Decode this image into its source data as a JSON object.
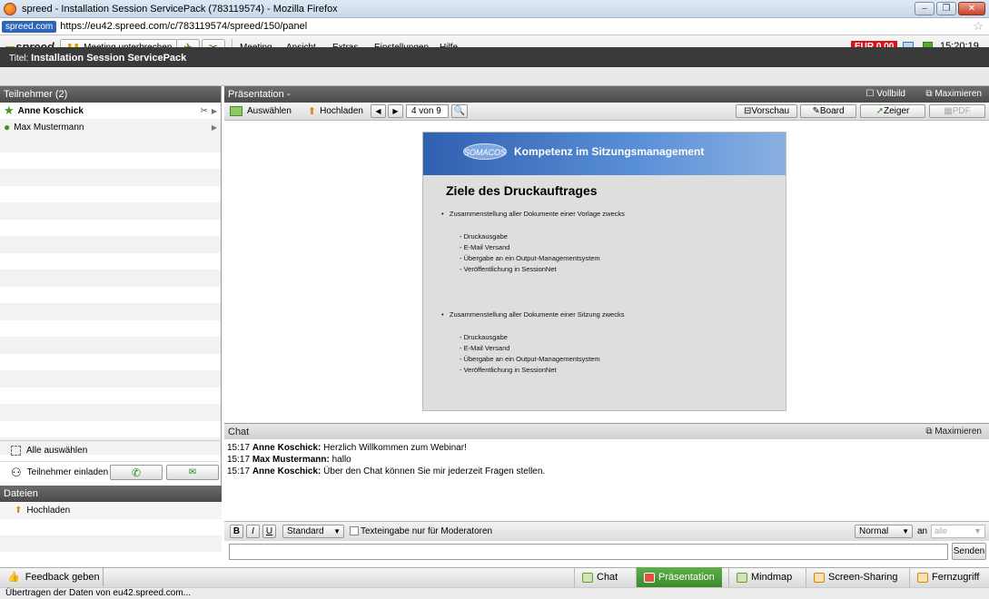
{
  "window": {
    "title": "spreed - Installation Session ServicePack (783119574) - Mozilla Firefox"
  },
  "urlbar": {
    "site": "spreed.com",
    "url": "https://eu42.spreed.com/c/783119574/spreed/150/panel"
  },
  "toolbar": {
    "logo": "spreed",
    "pause_label": "Meeting unterbrechen",
    "menu": [
      "Meeting",
      "Ansicht",
      "Extras",
      "Einstellungen",
      "Hilfe"
    ],
    "balance": "EUR 0,00",
    "time": "15:20:19"
  },
  "session": {
    "label": "Titel:",
    "title": "Installation Session ServicePack"
  },
  "participants": {
    "header": "Teilnehmer (2)",
    "items": [
      {
        "name": "Anne Koschick"
      },
      {
        "name": "Max Mustermann"
      }
    ],
    "select_all": "Alle auswählen",
    "invite": "Teilnehmer einladen"
  },
  "files": {
    "header": "Dateien",
    "upload": "Hochladen"
  },
  "presentation": {
    "header": "Präsentation -",
    "fullscreen": "Vollbild",
    "maximize": "Maximieren",
    "select": "Auswählen",
    "upload": "Hochladen",
    "page": "4 von 9",
    "preview": "Vorschau",
    "board": "Board",
    "pointer": "Zeiger",
    "pdf": "PDF",
    "slide": {
      "brand": "SOMACOS",
      "header": "Kompetenz im Sitzungsmanagement",
      "title": "Ziele des Druckauftrages",
      "b1": "Zusammenstellung aller Dokumente einer Vorlage zwecks",
      "l1": [
        "- Druckausgabe",
        "- E-Mail Versand",
        "- Übergabe an ein Output-Managementsystem",
        "- Veröffentlichung in SessionNet"
      ],
      "b2": "Zusammenstellung aller Dokumente einer Sitzung zwecks",
      "l2": [
        "- Druckausgabe",
        "- E-Mail Versand",
        "- Übergabe an ein Output-Managementsystem",
        "- Veröffentlichung in SessionNet"
      ]
    }
  },
  "chat": {
    "header": "Chat",
    "maximize": "Maximieren",
    "messages": [
      {
        "time": "15:17",
        "name": "Anne Koschick:",
        "text": "Herzlich Willkommen zum Webinar!"
      },
      {
        "time": "15:17",
        "name": "Max Mustermann:",
        "text": "hallo"
      },
      {
        "time": "15:17",
        "name": "Anne Koschick:",
        "text": "Über den Chat können Sie mir jederzeit Fragen stellen."
      }
    ],
    "font": "Standard",
    "mod_only": "Texteingabe nur für Moderatoren",
    "size": "Normal",
    "to": "an",
    "recipient": "alle",
    "send": "Senden"
  },
  "bottombar": {
    "feedback": "Feedback geben",
    "tabs": [
      "Chat",
      "Präsentation",
      "Mindmap",
      "Screen-Sharing",
      "Fernzugriff"
    ]
  },
  "status": "Übertragen der Daten von eu42.spreed.com..."
}
